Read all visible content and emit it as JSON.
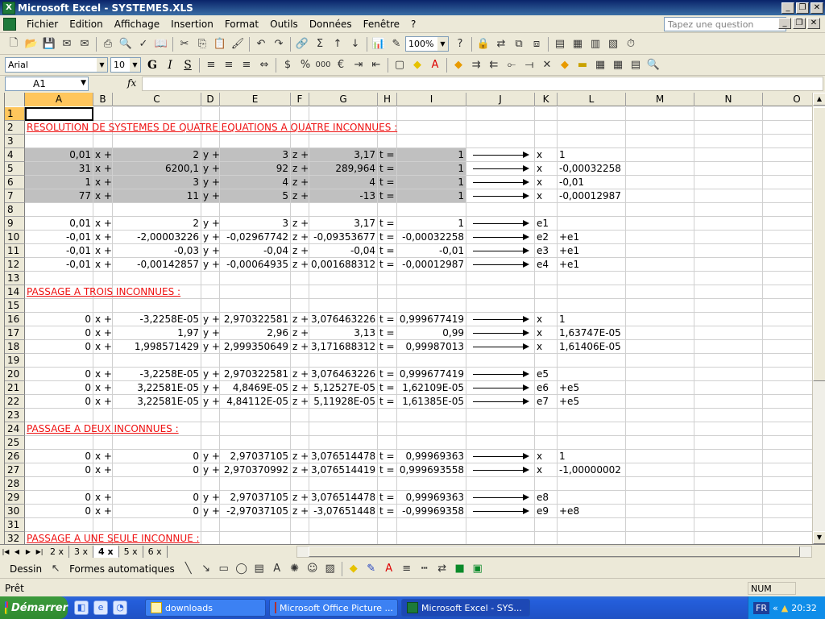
{
  "window": {
    "title": "Microsoft Excel - SYSTEMES.XLS"
  },
  "menu": [
    "Fichier",
    "Edition",
    "Affichage",
    "Insertion",
    "Format",
    "Outils",
    "Données",
    "Fenêtre",
    "?"
  ],
  "help": {
    "placeholder": "Tapez une question"
  },
  "toolbar": {
    "zoom": "100%",
    "font": "Arial",
    "size": "10"
  },
  "formula": {
    "cell_ref": "A1",
    "fx": "fx",
    "value": ""
  },
  "columns": [
    "A",
    "B",
    "C",
    "D",
    "E",
    "F",
    "G",
    "H",
    "I",
    "J",
    "K",
    "L",
    "M",
    "N",
    "O"
  ],
  "rows": [
    {
      "n": "1",
      "c": [
        "",
        "",
        "",
        "",
        "",
        "",
        "",
        "",
        "",
        "",
        "",
        ""
      ]
    },
    {
      "n": "2",
      "heading": "RESOLUTION DE SYSTEMES DE QUATRE EQUATIONS A QUATRE INCONNUES :"
    },
    {
      "n": "3",
      "c": [
        "",
        "",
        "",
        "",
        "",
        "",
        "",
        "",
        "",
        "",
        "",
        ""
      ]
    },
    {
      "n": "4",
      "shade": true,
      "c": [
        "0,01",
        "x +",
        "2",
        "y +",
        "3",
        "z +",
        "3,17",
        "t =",
        "1",
        "→",
        "x",
        "1"
      ]
    },
    {
      "n": "5",
      "shade": true,
      "c": [
        "31",
        "x +",
        "6200,1",
        "y +",
        "92",
        "z +",
        "289,964",
        "t =",
        "1",
        "→",
        "x",
        "-0,00032258"
      ]
    },
    {
      "n": "6",
      "shade": true,
      "c": [
        "1",
        "x +",
        "3",
        "y +",
        "4",
        "z +",
        "4",
        "t =",
        "1",
        "→",
        "x",
        "-0,01"
      ]
    },
    {
      "n": "7",
      "shade": true,
      "c": [
        "77",
        "x +",
        "11",
        "y +",
        "5",
        "z +",
        "-13",
        "t =",
        "1",
        "→",
        "x",
        "-0,00012987"
      ]
    },
    {
      "n": "8",
      "c": [
        "",
        "",
        "",
        "",
        "",
        "",
        "",
        "",
        "",
        "",
        "",
        ""
      ]
    },
    {
      "n": "9",
      "c": [
        "0,01",
        "x +",
        "2",
        "y +",
        "3",
        "z +",
        "3,17",
        "t =",
        "1",
        "→",
        "e1",
        ""
      ]
    },
    {
      "n": "10",
      "c": [
        "-0,01",
        "x +",
        "-2,00003226",
        "y +",
        "-0,02967742",
        "z +",
        "-0,09353677",
        "t =",
        "-0,00032258",
        "→",
        "e2",
        "+e1"
      ]
    },
    {
      "n": "11",
      "c": [
        "-0,01",
        "x +",
        "-0,03",
        "y +",
        "-0,04",
        "z +",
        "-0,04",
        "t =",
        "-0,01",
        "→",
        "e3",
        "+e1"
      ]
    },
    {
      "n": "12",
      "c": [
        "-0,01",
        "x +",
        "-0,00142857",
        "y +",
        "-0,00064935",
        "z +",
        "0,001688312",
        "t =",
        "-0,00012987",
        "→",
        "e4",
        "+e1"
      ]
    },
    {
      "n": "13",
      "c": [
        "",
        "",
        "",
        "",
        "",
        "",
        "",
        "",
        "",
        "",
        "",
        ""
      ]
    },
    {
      "n": "14",
      "heading": "PASSAGE A TROIS INCONNUES :"
    },
    {
      "n": "15",
      "c": [
        "",
        "",
        "",
        "",
        "",
        "",
        "",
        "",
        "",
        "",
        "",
        ""
      ]
    },
    {
      "n": "16",
      "c": [
        "0",
        "x +",
        "-3,2258E-05",
        "y +",
        "2,970322581",
        "z +",
        "3,076463226",
        "t =",
        "0,999677419",
        "→",
        "x",
        "1"
      ]
    },
    {
      "n": "17",
      "c": [
        "0",
        "x +",
        "1,97",
        "y +",
        "2,96",
        "z +",
        "3,13",
        "t =",
        "0,99",
        "→",
        "x",
        "1,63747E-05"
      ]
    },
    {
      "n": "18",
      "c": [
        "0",
        "x +",
        "1,998571429",
        "y +",
        "2,999350649",
        "z +",
        "3,171688312",
        "t =",
        "0,99987013",
        "→",
        "x",
        "1,61406E-05"
      ]
    },
    {
      "n": "19",
      "c": [
        "",
        "",
        "",
        "",
        "",
        "",
        "",
        "",
        "",
        "",
        "",
        ""
      ]
    },
    {
      "n": "20",
      "c": [
        "0",
        "x +",
        "-3,2258E-05",
        "y +",
        "2,970322581",
        "z +",
        "3,076463226",
        "t =",
        "0,999677419",
        "→",
        "e5",
        ""
      ]
    },
    {
      "n": "21",
      "c": [
        "0",
        "x +",
        "3,22581E-05",
        "y +",
        "4,8469E-05",
        "z +",
        "5,12527E-05",
        "t =",
        "1,62109E-05",
        "→",
        "e6",
        "+e5"
      ]
    },
    {
      "n": "22",
      "c": [
        "0",
        "x +",
        "3,22581E-05",
        "y +",
        "4,84112E-05",
        "z +",
        "5,11928E-05",
        "t =",
        "1,61385E-05",
        "→",
        "e7",
        "+e5"
      ]
    },
    {
      "n": "23",
      "c": [
        "",
        "",
        "",
        "",
        "",
        "",
        "",
        "",
        "",
        "",
        "",
        ""
      ]
    },
    {
      "n": "24",
      "heading": "PASSAGE A DEUX INCONNUES :"
    },
    {
      "n": "25",
      "c": [
        "",
        "",
        "",
        "",
        "",
        "",
        "",
        "",
        "",
        "",
        "",
        ""
      ]
    },
    {
      "n": "26",
      "c": [
        "0",
        "x +",
        "0",
        "y +",
        "2,97037105",
        "z +",
        "3,076514478",
        "t =",
        "0,99969363",
        "→",
        "x",
        "1"
      ]
    },
    {
      "n": "27",
      "c": [
        "0",
        "x +",
        "0",
        "y +",
        "2,970370992",
        "z +",
        "3,076514419",
        "t =",
        "0,999693558",
        "→",
        "x",
        "-1,00000002"
      ]
    },
    {
      "n": "28",
      "c": [
        "",
        "",
        "",
        "",
        "",
        "",
        "",
        "",
        "",
        "",
        "",
        ""
      ]
    },
    {
      "n": "29",
      "c": [
        "0",
        "x +",
        "0",
        "y +",
        "2,97037105",
        "z +",
        "3,076514478",
        "t =",
        "0,99969363",
        "→",
        "e8",
        ""
      ]
    },
    {
      "n": "30",
      "c": [
        "0",
        "x +",
        "0",
        "y +",
        "-2,97037105",
        "z +",
        "-3,07651448",
        "t =",
        "-0,99969358",
        "→",
        "e9",
        "+e8"
      ]
    },
    {
      "n": "31",
      "c": [
        "",
        "",
        "",
        "",
        "",
        "",
        "",
        "",
        "",
        "",
        "",
        ""
      ]
    },
    {
      "n": "32",
      "heading": "PASSAGE A UNE SEULE INCONNUE :"
    }
  ],
  "tabs": [
    "2 x",
    "3 x",
    "4 x",
    "5 x",
    "6 x"
  ],
  "active_tab": "4 x",
  "drawing": {
    "draw": "Dessin",
    "autoshapes": "Formes automatiques"
  },
  "status": {
    "text": "Prêt",
    "num": "NUM"
  },
  "taskbar": {
    "start": "Démarrer",
    "tasks": [
      "downloads",
      "Microsoft Office Picture ...",
      "Microsoft Excel - SYS..."
    ],
    "lang": "FR",
    "clock": "20:32"
  }
}
